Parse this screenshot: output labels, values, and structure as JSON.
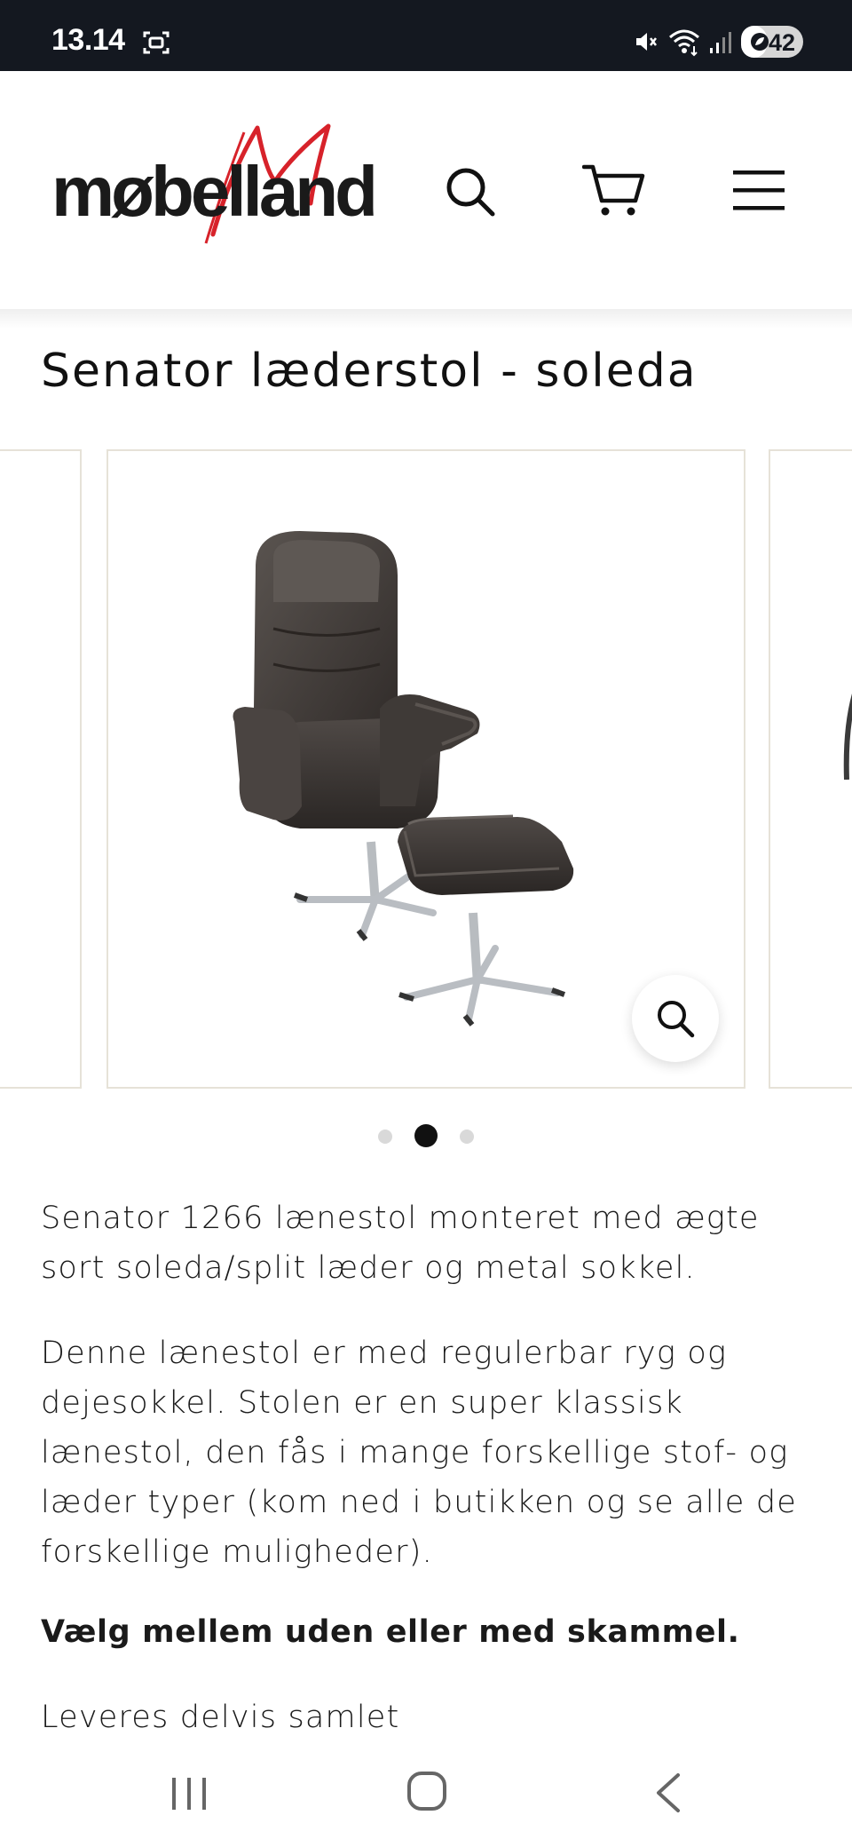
{
  "status_bar": {
    "time": "13.14",
    "battery_level": "42",
    "battery_percent": 42,
    "icons": [
      "screenshot-icon",
      "mute-icon",
      "wifi-icon",
      "signal-icon",
      "battery-icon"
    ]
  },
  "header": {
    "logo_text": "møbelland",
    "logo_accent_color": "#d7222a",
    "icons": [
      "search-icon",
      "cart-icon",
      "menu-icon"
    ]
  },
  "product": {
    "title": "Senator læderstol - soleda",
    "carousel": {
      "slide_count": 3,
      "active_index": 1
    },
    "description": [
      "Senator 1266 lænestol monteret med ægte sort soleda/split læder og metal sokkel.",
      "Denne lænestol er med regulerbar ryg og dejesokkel. Stolen er en super klassisk lænestol, den fås i mange forskellige stof- og læder typer (kom ned i butikken og se alle de forskellige muligheder)."
    ],
    "bold_note": "Vælg mellem uden eller med skammel.",
    "delivery_note": "Leveres delvis samlet"
  },
  "nav_bar": {
    "icons": [
      "recent-apps-icon",
      "home-icon",
      "back-icon"
    ]
  },
  "colors": {
    "status_bar_bg": "#141820",
    "slide_border": "#e6e2d8",
    "dot_active": "#111111",
    "dot_inactive": "#d9d9d9"
  }
}
